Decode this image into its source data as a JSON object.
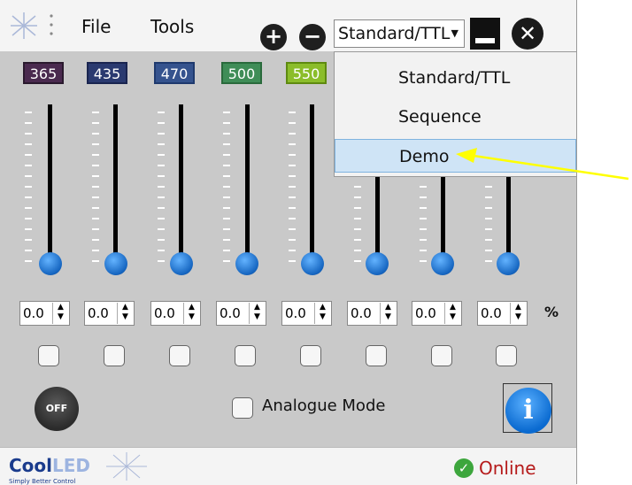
{
  "menu": {
    "file_label": "File",
    "tools_label": "Tools"
  },
  "toolbar": {
    "add_symbol": "+",
    "remove_symbol": "−",
    "close_symbol": "✕"
  },
  "mode_select": {
    "value": "Standard/TTL",
    "arrow": "▼"
  },
  "dropdown": {
    "items": [
      "Standard/TTL",
      "Sequence",
      "Demo"
    ],
    "selected": "Demo"
  },
  "channels": [
    {
      "wavelength": "365",
      "value": "0.0",
      "color": "#4a2a4f"
    },
    {
      "wavelength": "435",
      "value": "0.0",
      "color": "#2a3a70"
    },
    {
      "wavelength": "470",
      "value": "0.0",
      "color": "#35538e"
    },
    {
      "wavelength": "500",
      "value": "0.0",
      "color": "#3f8d57"
    },
    {
      "wavelength": "550",
      "value": "0.0",
      "color": "#8bbd2a"
    },
    {
      "wavelength": "",
      "value": "0.0",
      "color": "#c9c9c9"
    },
    {
      "wavelength": "",
      "value": "0.0",
      "color": "#c9c9c9"
    },
    {
      "wavelength": "",
      "value": "0.0",
      "color": "#c9c9c9"
    }
  ],
  "units": {
    "percent": "%"
  },
  "controls": {
    "off_label": "OFF",
    "analogue_label": "Analogue Mode",
    "info_symbol": "i"
  },
  "status": {
    "brand_cool": "Cool",
    "brand_led": "LED",
    "brand_tagline": "Simply Better Control",
    "online_label": "Online",
    "check_symbol": "✓"
  },
  "colors": {
    "accent_blue": "#1565c0",
    "online_red": "#b51a1a",
    "online_green": "#3da63d",
    "annotation_arrow": "#ffff00"
  }
}
